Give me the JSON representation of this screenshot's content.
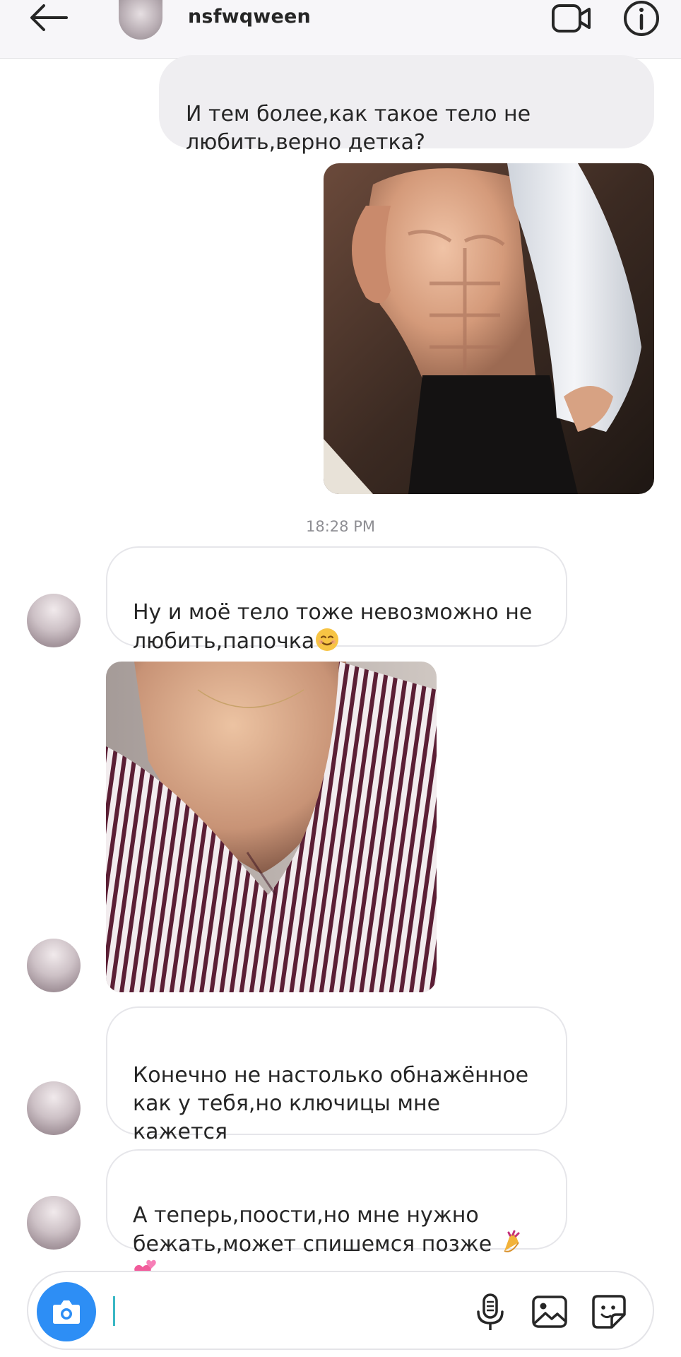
{
  "header": {
    "username": "nsfwqween",
    "icons": {
      "back": "arrow-left-icon",
      "video": "video-camera-icon",
      "info": "info-circle-icon"
    }
  },
  "messages": [
    {
      "direction": "outgoing",
      "type": "text",
      "text": "И тем более,как такое тело не\nлюбить,верно детка?"
    },
    {
      "direction": "outgoing",
      "type": "photo",
      "description": "torso in open white shirt"
    },
    {
      "type": "timestamp",
      "text": "18:28 PM"
    },
    {
      "direction": "incoming",
      "type": "text",
      "text": "Ну и моё тело тоже невозможно не\nлюбить,папочка",
      "emoji": "smiling-face-emoji"
    },
    {
      "direction": "incoming",
      "type": "photo",
      "description": "striped shirt off shoulder"
    },
    {
      "direction": "incoming",
      "type": "text",
      "text": "Конечно не настолько обнажённое\nкак у тебя,но ключицы мне кажется\nкруто получились,не так ли?"
    },
    {
      "direction": "incoming",
      "type": "text",
      "text": "А теперь,поости,но мне нужно\nбежать,может спишемся позже ",
      "emoji": "nail-polish-and-hearts-emoji"
    }
  ],
  "composer": {
    "value": "",
    "placeholder": "",
    "icons": {
      "camera": "camera-icon",
      "mic": "microphone-icon",
      "gallery": "image-gallery-icon",
      "sticker": "sticker-icon"
    }
  },
  "colors": {
    "header_bg": "#f7f6f9",
    "outgoing_bubble": "#efeef1",
    "incoming_border": "#e6e6ea",
    "camera_button": "#2d8ef5",
    "caret": "#39b7c4",
    "timestamp": "#8e8e93"
  }
}
